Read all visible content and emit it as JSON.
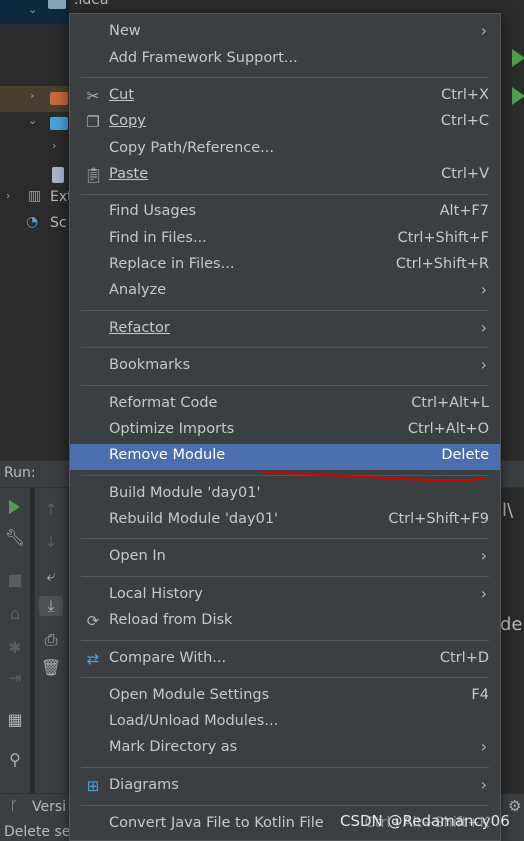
{
  "project_tree": {
    "rows": [
      {
        "label": ".idea"
      },
      {
        "label": ""
      },
      {
        "label": ""
      },
      {
        "label": ""
      },
      {
        "label": ""
      },
      {
        "label": "Ext"
      },
      {
        "label": "Sc"
      }
    ]
  },
  "run_panel": {
    "label": "Run:"
  },
  "status_bar": {
    "version_label": "Versi",
    "message": "Delete se"
  },
  "console": {
    "fragment_1": "l\\",
    "fragment_2": "de"
  },
  "context_menu": {
    "items": [
      {
        "label": "New",
        "shortcut": "",
        "submenu": true
      },
      {
        "label": "Add Framework Support...",
        "shortcut": "",
        "submenu": false
      },
      {
        "label": "Cut",
        "shortcut": "Ctrl+X",
        "submenu": false,
        "icon": "cut-icon"
      },
      {
        "label": "Copy",
        "shortcut": "Ctrl+C",
        "submenu": false,
        "icon": "copy-icon"
      },
      {
        "label": "Copy Path/Reference...",
        "shortcut": "",
        "submenu": false
      },
      {
        "label": "Paste",
        "shortcut": "Ctrl+V",
        "submenu": false,
        "icon": "paste-icon"
      },
      {
        "label": "Find Usages",
        "shortcut": "Alt+F7",
        "submenu": false
      },
      {
        "label": "Find in Files...",
        "shortcut": "Ctrl+Shift+F",
        "submenu": false
      },
      {
        "label": "Replace in Files...",
        "shortcut": "Ctrl+Shift+R",
        "submenu": false
      },
      {
        "label": "Analyze",
        "shortcut": "",
        "submenu": true
      },
      {
        "label": "Refactor",
        "shortcut": "",
        "submenu": true
      },
      {
        "label": "Bookmarks",
        "shortcut": "",
        "submenu": true
      },
      {
        "label": "Reformat Code",
        "shortcut": "Ctrl+Alt+L",
        "submenu": false
      },
      {
        "label": "Optimize Imports",
        "shortcut": "Ctrl+Alt+O",
        "submenu": false
      },
      {
        "label": "Remove Module",
        "shortcut": "Delete",
        "submenu": false,
        "active": true
      },
      {
        "label": "Build Module 'day01'",
        "shortcut": "",
        "submenu": false
      },
      {
        "label": "Rebuild Module 'day01'",
        "shortcut": "Ctrl+Shift+F9",
        "submenu": false
      },
      {
        "label": "Open In",
        "shortcut": "",
        "submenu": true
      },
      {
        "label": "Local History",
        "shortcut": "",
        "submenu": true
      },
      {
        "label": "Reload from Disk",
        "shortcut": "",
        "submenu": false,
        "icon": "reload-icon"
      },
      {
        "label": "Compare With...",
        "shortcut": "Ctrl+D",
        "submenu": false,
        "icon": "compare-icon"
      },
      {
        "label": "Open Module Settings",
        "shortcut": "F4",
        "submenu": false
      },
      {
        "label": "Load/Unload Modules...",
        "shortcut": "",
        "submenu": false
      },
      {
        "label": "Mark Directory as",
        "shortcut": "",
        "submenu": true
      },
      {
        "label": "Diagrams",
        "shortcut": "",
        "submenu": true,
        "icon": "diagram-icon"
      },
      {
        "label": "Convert Java File to Kotlin File",
        "shortcut": "Ctrl+Alt+Shift+K",
        "submenu": false
      }
    ],
    "submenu_arrow": "›"
  },
  "watermark": {
    "text": "CSDN @Redamancy06"
  },
  "colors": {
    "menu_bg": "#3c3f41",
    "highlight": "#4b6eaf",
    "ide_bg": "#2b2b2b",
    "annotation": "#d40000",
    "run_green": "#4fa14b"
  }
}
